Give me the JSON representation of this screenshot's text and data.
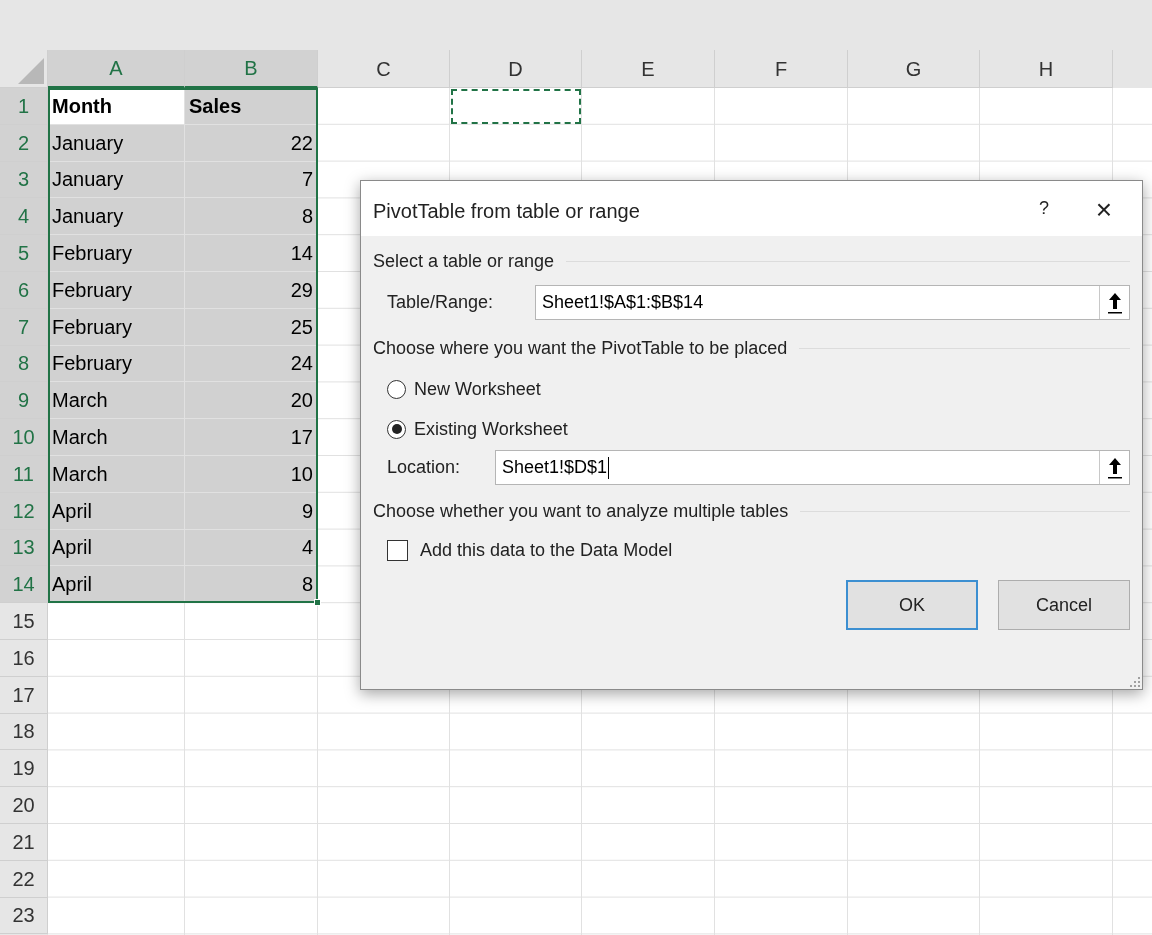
{
  "columns": [
    {
      "label": "A",
      "selected": true
    },
    {
      "label": "B",
      "selected": true
    },
    {
      "label": "C",
      "selected": false
    },
    {
      "label": "D",
      "selected": false
    },
    {
      "label": "E",
      "selected": false
    },
    {
      "label": "F",
      "selected": false
    },
    {
      "label": "G",
      "selected": false
    },
    {
      "label": "H",
      "selected": false
    }
  ],
  "rows": [
    {
      "label": "1",
      "selected": true,
      "kind": "header",
      "cells": [
        {
          "text": "Month",
          "marquee": false
        },
        {
          "text": "Sales",
          "marquee": false
        },
        {
          "marquee": false
        },
        {
          "marquee": true
        }
      ]
    },
    {
      "label": "2",
      "selected": true,
      "kind": "data",
      "cells": [
        {
          "text": "January"
        },
        {
          "text": "22"
        }
      ]
    },
    {
      "label": "3",
      "selected": true,
      "kind": "data",
      "cells": [
        {
          "text": "January"
        },
        {
          "text": "7"
        }
      ]
    },
    {
      "label": "4",
      "selected": true,
      "kind": "data",
      "cells": [
        {
          "text": "January"
        },
        {
          "text": "8"
        }
      ]
    },
    {
      "label": "5",
      "selected": true,
      "kind": "data",
      "cells": [
        {
          "text": "February"
        },
        {
          "text": "14"
        }
      ]
    },
    {
      "label": "6",
      "selected": true,
      "kind": "data",
      "cells": [
        {
          "text": "February"
        },
        {
          "text": "29"
        }
      ]
    },
    {
      "label": "7",
      "selected": true,
      "kind": "data",
      "cells": [
        {
          "text": "February"
        },
        {
          "text": "25"
        }
      ]
    },
    {
      "label": "8",
      "selected": true,
      "kind": "data",
      "cells": [
        {
          "text": "February"
        },
        {
          "text": "24"
        }
      ]
    },
    {
      "label": "9",
      "selected": true,
      "kind": "data",
      "cells": [
        {
          "text": "March"
        },
        {
          "text": "20"
        }
      ]
    },
    {
      "label": "10",
      "selected": true,
      "kind": "data",
      "cells": [
        {
          "text": "March"
        },
        {
          "text": "17"
        }
      ]
    },
    {
      "label": "11",
      "selected": true,
      "kind": "data",
      "cells": [
        {
          "text": "March"
        },
        {
          "text": "10"
        }
      ]
    },
    {
      "label": "12",
      "selected": true,
      "kind": "data",
      "cells": [
        {
          "text": "April"
        },
        {
          "text": "9"
        }
      ]
    },
    {
      "label": "13",
      "selected": true,
      "kind": "data",
      "cells": [
        {
          "text": "April"
        },
        {
          "text": "4"
        }
      ]
    },
    {
      "label": "14",
      "selected": true,
      "kind": "data",
      "cells": [
        {
          "text": "April"
        },
        {
          "text": "8"
        }
      ]
    },
    {
      "label": "15",
      "selected": false
    },
    {
      "label": "16",
      "selected": false
    },
    {
      "label": "17",
      "selected": false
    },
    {
      "label": "18",
      "selected": false
    },
    {
      "label": "19",
      "selected": false
    },
    {
      "label": "20",
      "selected": false
    },
    {
      "label": "21",
      "selected": false
    },
    {
      "label": "22",
      "selected": false
    },
    {
      "label": "23",
      "selected": false
    }
  ],
  "dialog": {
    "title": "PivotTable from table or range",
    "help": "?",
    "close": "×",
    "source": {
      "heading": "Select a table or range",
      "field": {
        "label": "Table/Range:",
        "value": "Sheet1!$A$1:$B$14",
        "focused": false
      }
    },
    "placement": {
      "heading": "Choose where you want the PivotTable to be placed",
      "options": [
        {
          "label": "New Worksheet",
          "selected": false
        },
        {
          "label": "Existing Worksheet",
          "selected": true
        }
      ],
      "field": {
        "label": "Location:",
        "value": "Sheet1!$D$1",
        "focused": true
      }
    },
    "analysis": {
      "heading": "Choose whether you want to analyze multiple tables",
      "checkbox": {
        "label": "Add this data to the Data Model",
        "checked": false
      }
    },
    "buttons": [
      {
        "label": "OK",
        "default": true
      },
      {
        "label": "Cancel",
        "default": false
      }
    ]
  }
}
